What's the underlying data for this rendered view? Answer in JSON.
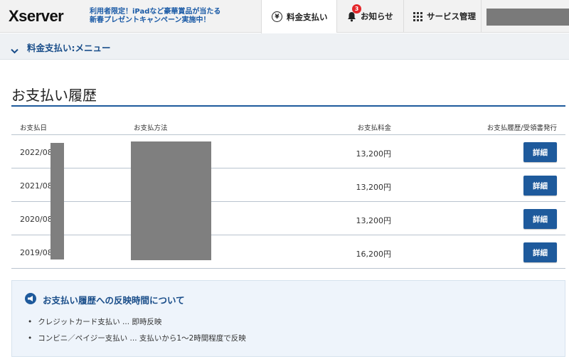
{
  "header": {
    "logo": "Xserver",
    "promo_line1": "利用者限定！iPadなど豪華賞品が当たる",
    "promo_line2": "新春プレゼントキャンペーン実施中！",
    "nav": {
      "pay": "料金支払い",
      "news": "お知らせ",
      "news_badge": "3",
      "services": "サービス管理"
    }
  },
  "submenu": {
    "label": "料金支払い:メニュー"
  },
  "page": {
    "title": "お支払い履歴"
  },
  "table": {
    "headers": {
      "date": "お支払日",
      "method": "お支払方法",
      "amount": "お支払料金",
      "receipt": "お支払履歴/受領書発行"
    },
    "rows": [
      {
        "date": "2022/08",
        "amount": "13,200円",
        "button": "詳細"
      },
      {
        "date": "2021/08",
        "amount": "13,200円",
        "button": "詳細"
      },
      {
        "date": "2020/08",
        "amount": "13,200円",
        "button": "詳細"
      },
      {
        "date": "2019/08",
        "amount": "16,200円",
        "button": "詳細"
      }
    ]
  },
  "info": {
    "title": "お支払い履歴への反映時間について",
    "items": [
      "クレジットカード支払い ... 即時反映",
      "コンビニ／ペイジー支払い ... 支払いから1～2時間程度で反映"
    ]
  },
  "colors": {
    "brand_blue": "#1e5a9c",
    "badge_red": "#e4262a"
  }
}
